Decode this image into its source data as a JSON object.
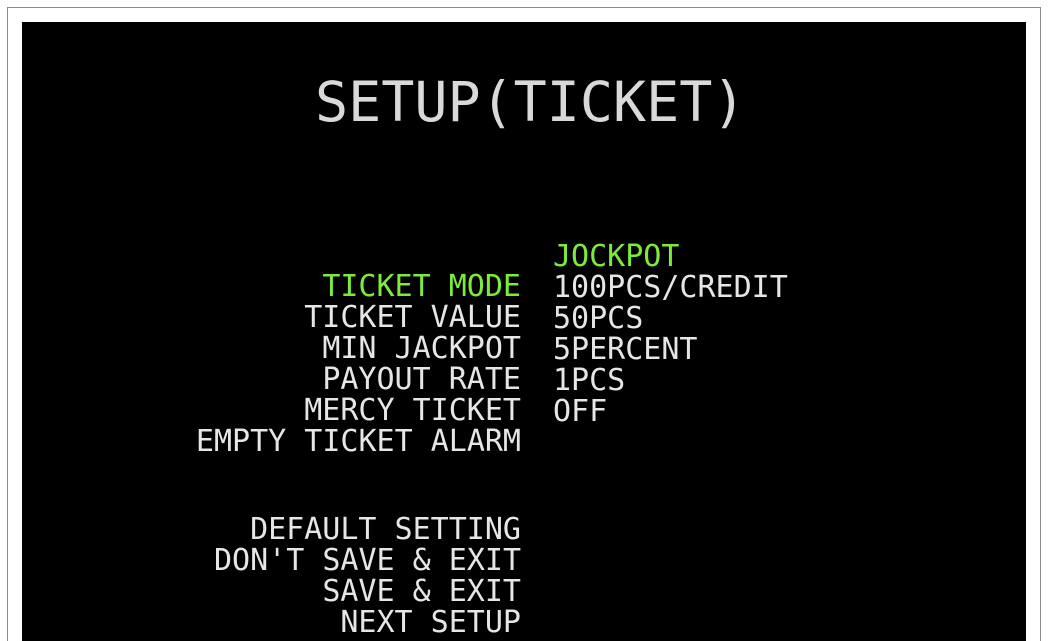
{
  "screen": {
    "title": "SETUP(TICKET)"
  },
  "settings": [
    {
      "label": "TICKET MODE",
      "value": "JOCKPOT",
      "selected": true
    },
    {
      "label": "TICKET VALUE",
      "value": "100PCS/CREDIT",
      "selected": false
    },
    {
      "label": "MIN JACKPOT",
      "value": "50PCS",
      "selected": false
    },
    {
      "label": "PAYOUT RATE",
      "value": "5PERCENT",
      "selected": false
    },
    {
      "label": "MERCY TICKET",
      "value": "1PCS",
      "selected": false
    },
    {
      "label": "EMPTY TICKET ALARM",
      "value": "OFF",
      "selected": false
    }
  ],
  "actions": [
    {
      "label": "DEFAULT SETTING"
    },
    {
      "label": "DON'T SAVE & EXIT"
    },
    {
      "label": "SAVE & EXIT"
    },
    {
      "label": "NEXT SETUP"
    }
  ],
  "colors": {
    "background": "#000000",
    "text": "#e6e6e6",
    "title": "#d9d9d9",
    "highlight": "#7cec3a",
    "frame_border": "#8a8a8a"
  }
}
